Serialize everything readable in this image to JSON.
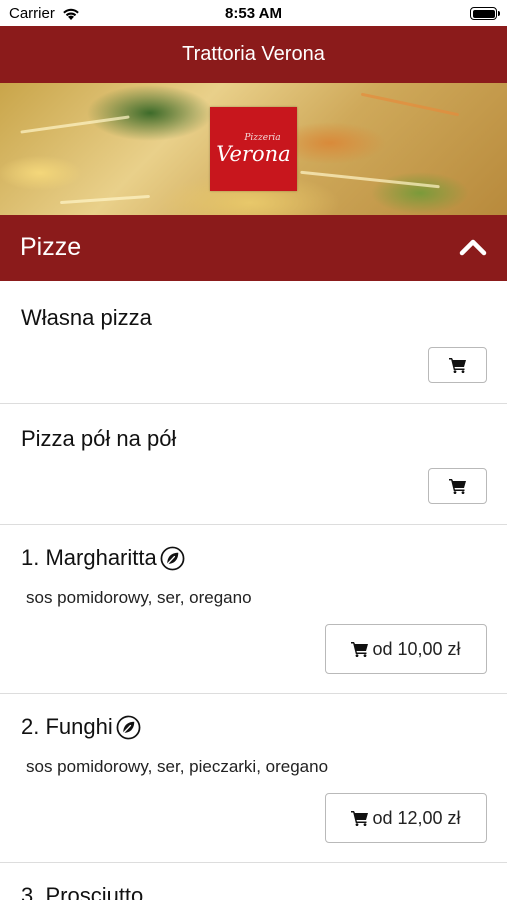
{
  "status_bar": {
    "carrier": "Carrier",
    "time": "8:53 AM"
  },
  "header": {
    "title": "Trattoria Verona"
  },
  "logo": {
    "line1": "Pizzeria",
    "line2": "Verona"
  },
  "section": {
    "title": "Pizze"
  },
  "colors": {
    "brand": "#8b1b1b",
    "logo_red": "#c8161d"
  },
  "items": [
    {
      "name": "Własna pizza"
    },
    {
      "name": "Pizza pół na pół"
    },
    {
      "name": "1. Margharitta",
      "description": "sos pomidorowy, ser, oregano",
      "price": "od 10,00 zł",
      "icon": "leaf-icon"
    },
    {
      "name": "2. Funghi",
      "description": "sos pomidorowy, ser, pieczarki, oregano",
      "price": "od 12,00 zł",
      "icon": "leaf-icon"
    },
    {
      "name": "3. Prosciutto"
    }
  ]
}
